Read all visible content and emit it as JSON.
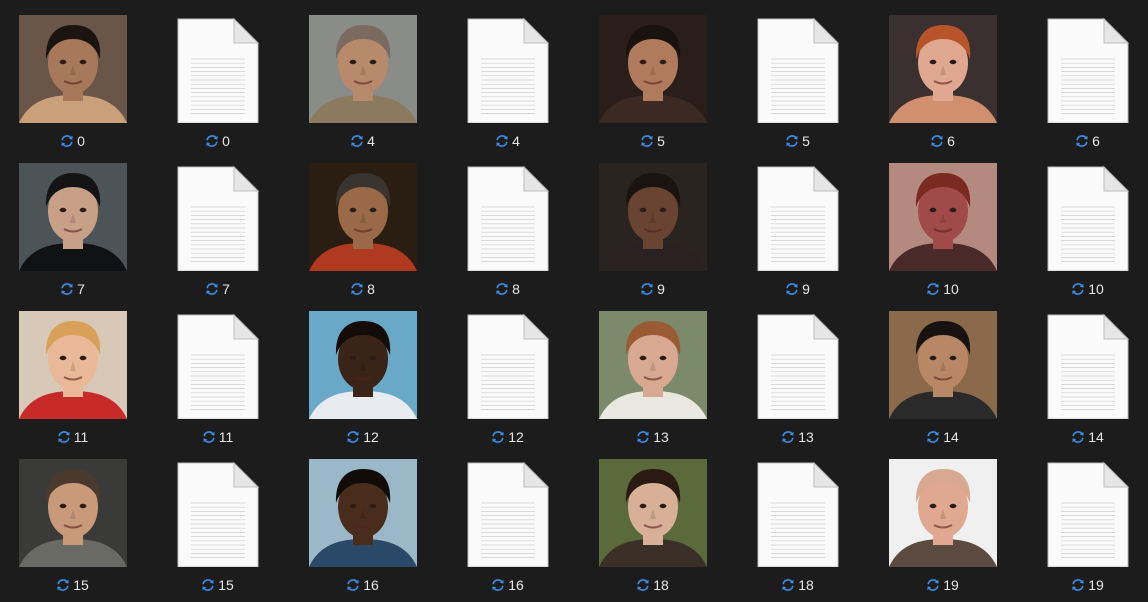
{
  "colors": {
    "background": "#1c1c1c",
    "label_text": "#e6e6e6",
    "sync_icon": "#3b8ee6",
    "doc_paper": "#fafafa",
    "doc_lines": "#cfcfcf"
  },
  "icons": {
    "sync": "sync-icon",
    "document": "document-icon"
  },
  "items": [
    {
      "kind": "photo",
      "label": "0",
      "photo": {
        "bg": "#6a5648",
        "skin": "#a8785a",
        "hair": "#1b1410",
        "cloth": "#c9a07a"
      }
    },
    {
      "kind": "document",
      "label": "0"
    },
    {
      "kind": "photo",
      "label": "4",
      "photo": {
        "bg": "#8a8c88",
        "skin": "#b88a6c",
        "hair": "#7a6a60",
        "cloth": "#8c7a5e"
      }
    },
    {
      "kind": "document",
      "label": "4"
    },
    {
      "kind": "photo",
      "label": "5",
      "photo": {
        "bg": "#2a1e1a",
        "skin": "#b07a5c",
        "hair": "#1a120e",
        "cloth": "#3a2a22"
      }
    },
    {
      "kind": "document",
      "label": "5"
    },
    {
      "kind": "photo",
      "label": "6",
      "photo": {
        "bg": "#3a3030",
        "skin": "#e0a890",
        "hair": "#b8542a",
        "cloth": "#d09070"
      }
    },
    {
      "kind": "document",
      "label": "6"
    },
    {
      "kind": "photo",
      "label": "7",
      "photo": {
        "bg": "#4c5458",
        "skin": "#c8a088",
        "hair": "#141414",
        "cloth": "#101214"
      }
    },
    {
      "kind": "document",
      "label": "7"
    },
    {
      "kind": "photo",
      "label": "8",
      "photo": {
        "bg": "#2a1e12",
        "skin": "#9a6a48",
        "hair": "#3a3430",
        "cloth": "#b03a20"
      }
    },
    {
      "kind": "document",
      "label": "8"
    },
    {
      "kind": "photo",
      "label": "9",
      "photo": {
        "bg": "#2a2420",
        "skin": "#6a4432",
        "hair": "#1a1410",
        "cloth": "#2a2222"
      }
    },
    {
      "kind": "document",
      "label": "9"
    },
    {
      "kind": "photo",
      "label": "10",
      "photo": {
        "bg": "#b48a80",
        "skin": "#a04a4a",
        "hair": "#7a2a20",
        "cloth": "#4a2a28"
      }
    },
    {
      "kind": "document",
      "label": "10"
    },
    {
      "kind": "photo",
      "label": "11",
      "photo": {
        "bg": "#d8c8b8",
        "skin": "#e8b898",
        "hair": "#d8a058",
        "cloth": "#c82a2a"
      }
    },
    {
      "kind": "document",
      "label": "11"
    },
    {
      "kind": "photo",
      "label": "12",
      "photo": {
        "bg": "#6aa8c8",
        "skin": "#3a2418",
        "hair": "#140c08",
        "cloth": "#e8ecf0"
      }
    },
    {
      "kind": "document",
      "label": "12"
    },
    {
      "kind": "photo",
      "label": "13",
      "photo": {
        "bg": "#7a8a6a",
        "skin": "#d8a890",
        "hair": "#9a5a34",
        "cloth": "#e8e8e0"
      }
    },
    {
      "kind": "document",
      "label": "13"
    },
    {
      "kind": "photo",
      "label": "14",
      "photo": {
        "bg": "#8a6a4a",
        "skin": "#b88866",
        "hair": "#181210",
        "cloth": "#2a2a2a"
      }
    },
    {
      "kind": "document",
      "label": "14"
    },
    {
      "kind": "photo",
      "label": "15",
      "photo": {
        "bg": "#3a3a38",
        "skin": "#c89a7a",
        "hair": "#4a3a2e",
        "cloth": "#6a6a64"
      }
    },
    {
      "kind": "document",
      "label": "15"
    },
    {
      "kind": "photo",
      "label": "16",
      "photo": {
        "bg": "#9ab8c8",
        "skin": "#4a2c1c",
        "hair": "#120c08",
        "cloth": "#2a4868"
      }
    },
    {
      "kind": "document",
      "label": "16"
    },
    {
      "kind": "photo",
      "label": "18",
      "photo": {
        "bg": "#5a6a3a",
        "skin": "#d8b098",
        "hair": "#2a1a12",
        "cloth": "#3a3028"
      }
    },
    {
      "kind": "document",
      "label": "18"
    },
    {
      "kind": "photo",
      "label": "19",
      "photo": {
        "bg": "#f0f0f0",
        "skin": "#e0a890",
        "hair": "#d8a890",
        "cloth": "#5a4a40"
      }
    },
    {
      "kind": "document",
      "label": "19"
    }
  ]
}
